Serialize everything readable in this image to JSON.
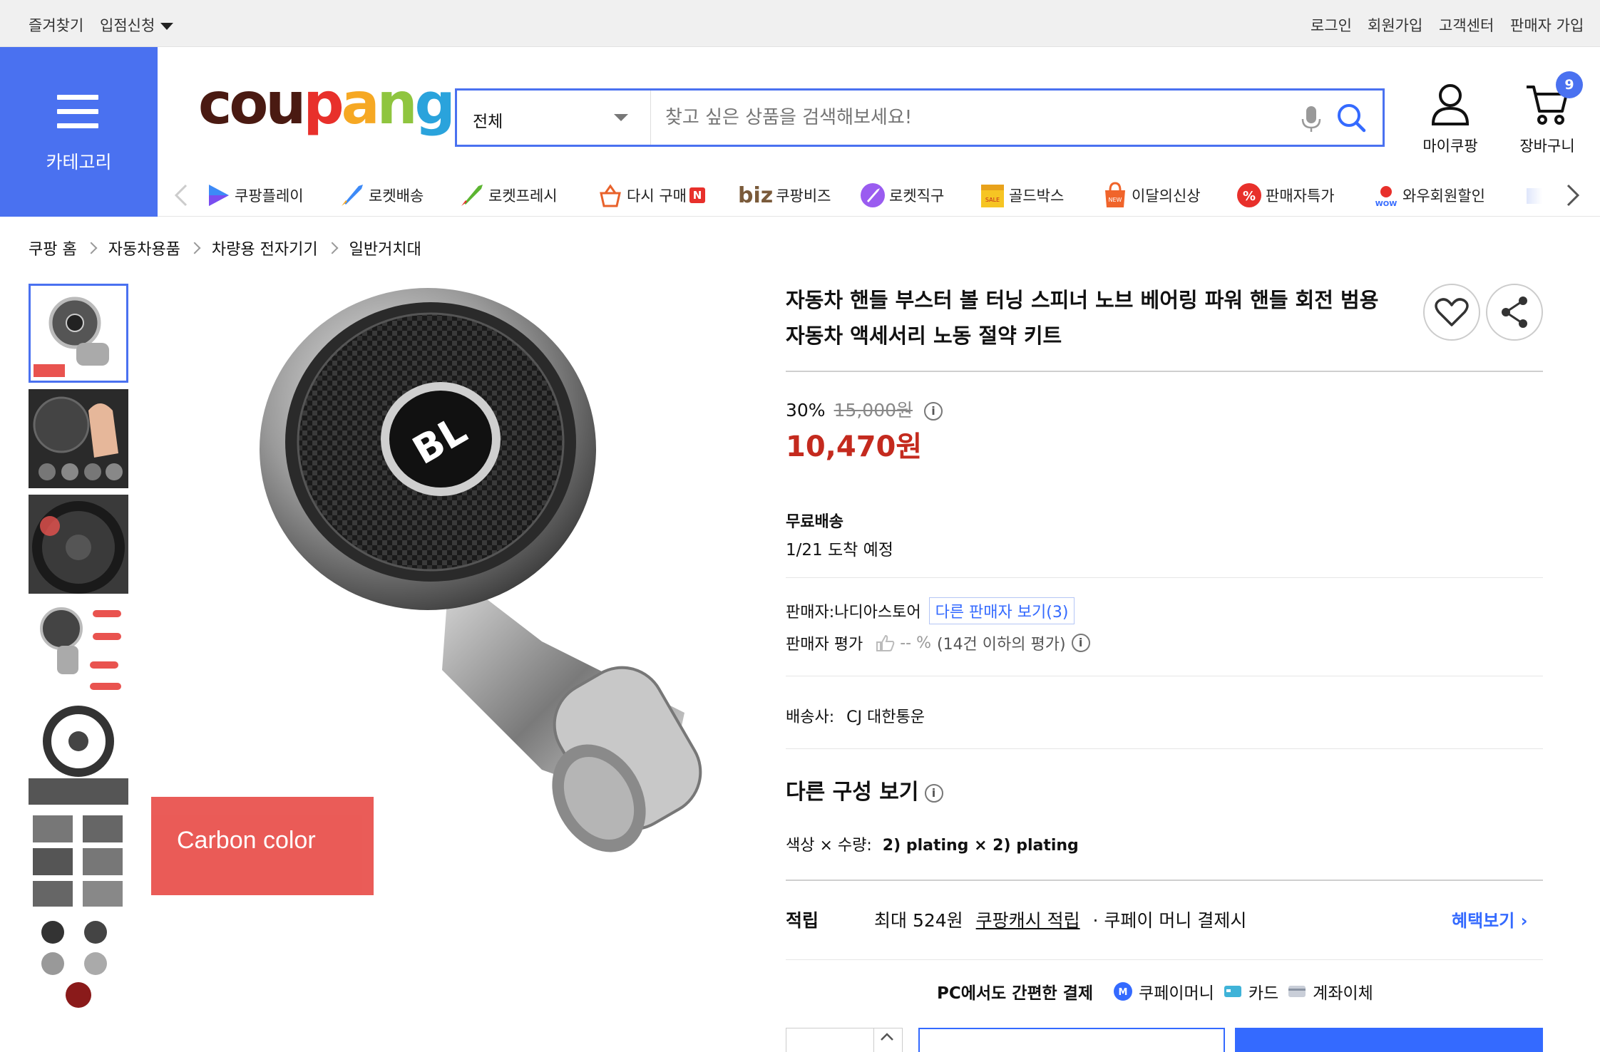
{
  "topbar": {
    "favorites": "즐겨찾기",
    "store_apply": "입점신청",
    "login": "로그인",
    "signup": "회원가입",
    "customer_center": "고객센터",
    "seller_signup": "판매자 가입"
  },
  "header": {
    "category_label": "카테고리",
    "logo_text": "coupang",
    "search_select": "전체",
    "search_placeholder": "찾고 싶은 상품을 검색해보세요!",
    "mycoupang": "마이쿠팡",
    "cart": "장바구니",
    "cart_count": "9"
  },
  "category_strip": [
    {
      "label": "쿠팡플레이",
      "icon": "coupang-play-icon"
    },
    {
      "label": "로켓배송",
      "icon": "rocket-delivery-icon"
    },
    {
      "label": "로켓프레시",
      "icon": "rocket-fresh-icon"
    },
    {
      "label": "다시 구매",
      "icon": "rebuy-icon"
    },
    {
      "label": "쿠팡비즈",
      "icon": "biz-icon",
      "prefix": "biz"
    },
    {
      "label": "로켓직구",
      "icon": "rocket-global-icon"
    },
    {
      "label": "골드박스",
      "icon": "goldbox-icon"
    },
    {
      "label": "이달의신상",
      "icon": "new-arrival-icon"
    },
    {
      "label": "판매자특가",
      "icon": "seller-deal-icon"
    },
    {
      "label": "와우회원할인",
      "icon": "wow-discount-icon"
    }
  ],
  "breadcrumb": [
    "쿠팡 홈",
    "자동차용품",
    "차량용 전자기기",
    "일반거치대"
  ],
  "product": {
    "title_line1": "자동차 핸들 부스터 볼 터닝 스피너 노브 베어링 파워 핸들 회전 범용",
    "title_line2": "자동차 액세서리 노동 절약 키트",
    "discount_rate": "30%",
    "original_price": "15,000원",
    "sale_price": "10,470원",
    "image_tag": "Carbon color",
    "image_logo": "BL"
  },
  "shipping": {
    "type": "무료배송",
    "arrival": "1/21 도착 예정"
  },
  "seller": {
    "name_label": "판매자:나디아스토어",
    "other_sellers": "다른 판매자 보기(3)",
    "rating_label": "판매자 평가",
    "rating_value": "-- %",
    "rating_note": "(14건 이하의 평가)"
  },
  "carrier": {
    "label": "배송사:",
    "name": "CJ 대한통운"
  },
  "options": {
    "title": "다른 구성 보기",
    "label": "색상 × 수량:",
    "value": "2) plating × 2) plating"
  },
  "points": {
    "label": "적립",
    "max": "최대 524원",
    "cash": "쿠팡캐시 적립",
    "pay": "· 쿠페이 머니 결제시",
    "benefit_link": "혜택보기 ›"
  },
  "payment": {
    "title": "PC에서도 간편한 결제",
    "method1": "쿠페이머니",
    "method2": "카드",
    "method3": "계좌이체"
  },
  "colors": {
    "brand_blue": "#4a71f0",
    "link_blue": "#346aff",
    "price_red": "#c42a1e",
    "tag_red": "#e9534f"
  }
}
